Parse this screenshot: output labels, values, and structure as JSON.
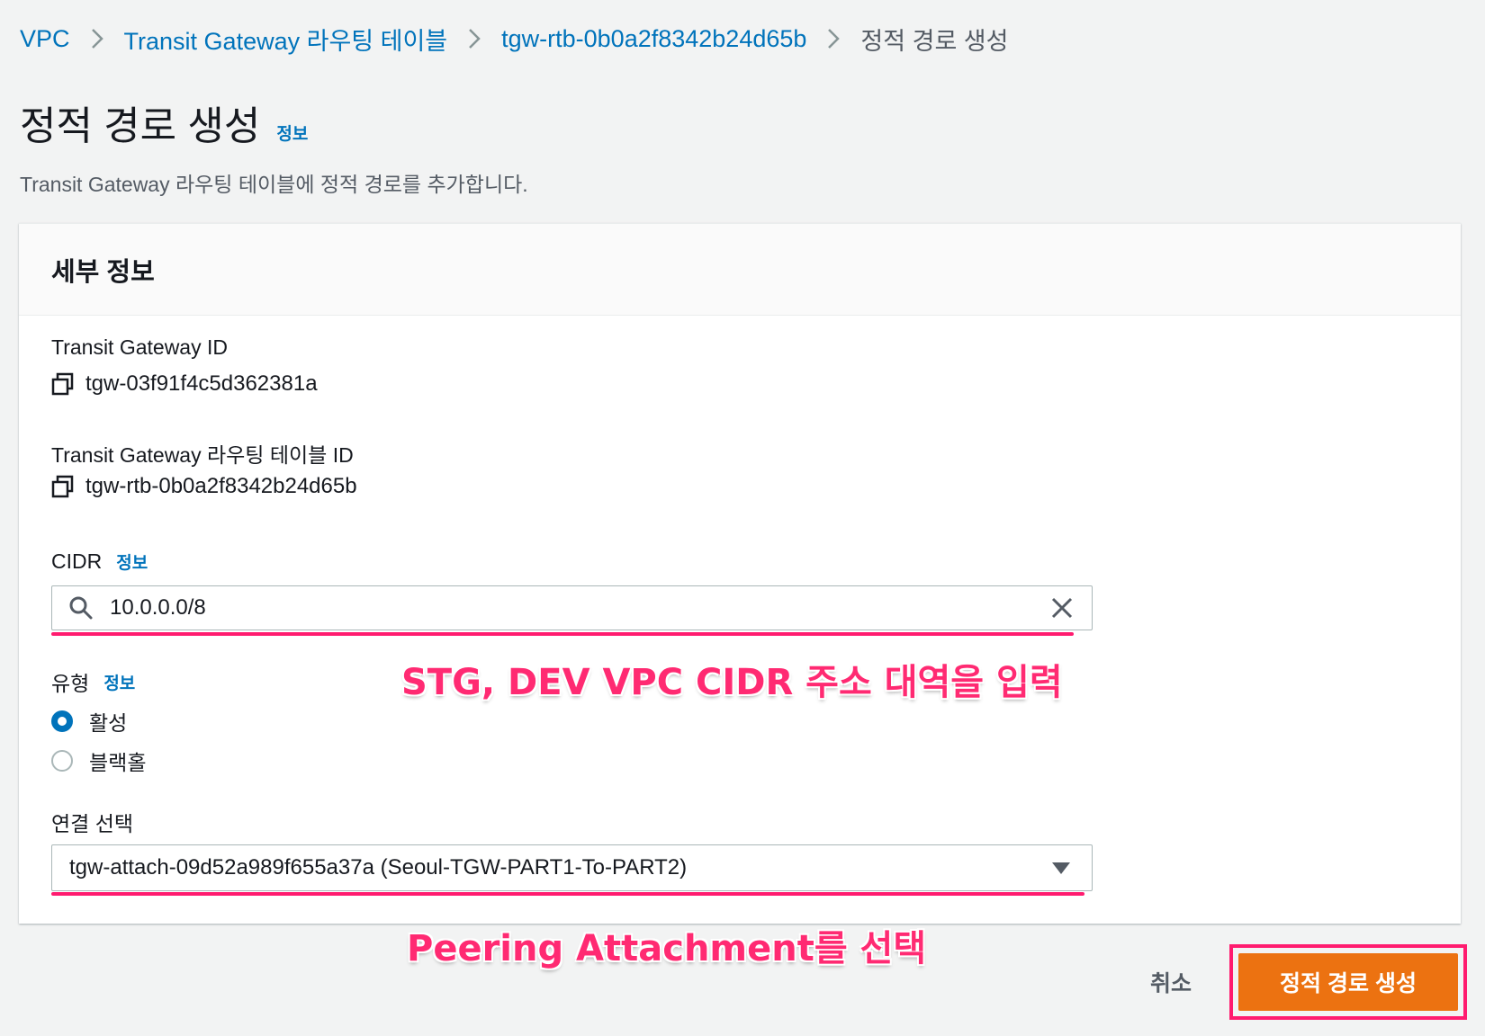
{
  "breadcrumb": {
    "items": [
      "VPC",
      "Transit Gateway 라우팅 테이블",
      "tgw-rtb-0b0a2f8342b24d65b"
    ],
    "current": "정적 경로 생성"
  },
  "page": {
    "title": "정적 경로 생성",
    "info_label": "정보",
    "description": "Transit Gateway 라우팅 테이블에 정적 경로를 추가합니다."
  },
  "panel": {
    "title": "세부 정보",
    "tgw_id_label": "Transit Gateway ID",
    "tgw_id_value": "tgw-03f91f4c5d362381a",
    "rtb_id_label": "Transit Gateway 라우팅 테이블 ID",
    "rtb_id_value": "tgw-rtb-0b0a2f8342b24d65b",
    "cidr_label": "CIDR",
    "cidr_info": "정보",
    "cidr_value": "10.0.0.0/8",
    "type_label": "유형",
    "type_info": "정보",
    "type_options": [
      {
        "label": "활성",
        "selected": true
      },
      {
        "label": "블랙홀",
        "selected": false
      }
    ],
    "attachment_label": "연결 선택",
    "attachment_value": "tgw-attach-09d52a989f655a37a (Seoul-TGW-PART1-To-PART2)"
  },
  "annotations": {
    "cidr_note": "STG, DEV VPC CIDR 주소 대역을 입력",
    "attachment_note": "Peering Attachment를 선택",
    "color": "#ff2a72"
  },
  "actions": {
    "cancel": "취소",
    "submit": "정적 경로 생성",
    "submit_color": "#ec7211"
  },
  "icons": {
    "copy": "copy-icon",
    "search": "search-icon",
    "clear": "close-icon",
    "caret": "caret-down-icon"
  }
}
